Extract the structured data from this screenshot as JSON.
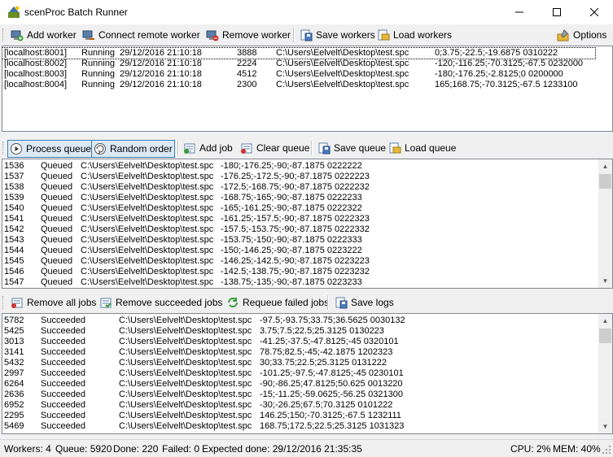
{
  "window": {
    "title": "scenProc Batch Runner"
  },
  "workers_toolbar": {
    "add_worker": "Add worker",
    "connect_remote_worker": "Connect remote worker",
    "remove_worker": "Remove worker",
    "save_workers": "Save workers",
    "load_workers": "Load workers",
    "options": "Options"
  },
  "workers": [
    {
      "host": "[localhost:8001]",
      "status": "Running",
      "started": "29/12/2016 21:10:18",
      "pid": "3888",
      "file": "C:\\Users\\Eelvelt\\Desktop\\test.spc",
      "args": "0;3.75;-22.5;-19.6875 0310222"
    },
    {
      "host": "[localhost:8002]",
      "status": "Running",
      "started": "29/12/2016 21:10:18",
      "pid": "2224",
      "file": "C:\\Users\\Eelvelt\\Desktop\\test.spc",
      "args": "-120;-116.25;-70.3125;-67.5 0232000"
    },
    {
      "host": "[localhost:8003]",
      "status": "Running",
      "started": "29/12/2016 21:10:18",
      "pid": "4512",
      "file": "C:\\Users\\Eelvelt\\Desktop\\test.spc",
      "args": "-180;-176.25;-2.8125;0 0200000"
    },
    {
      "host": "[localhost:8004]",
      "status": "Running",
      "started": "29/12/2016 21:10:18",
      "pid": "2300",
      "file": "C:\\Users\\Eelvelt\\Desktop\\test.spc",
      "args": "165;168.75;-70.3125;-67.5 1233100"
    }
  ],
  "queue_toolbar": {
    "process_queue": "Process queue",
    "random_order": "Random order",
    "add_job": "Add job",
    "clear_queue": "Clear queue",
    "save_queue": "Save queue",
    "load_queue": "Load queue"
  },
  "queue": [
    {
      "id": "1536",
      "status": "Queued",
      "file": "C:\\Users\\Eelvelt\\Desktop\\test.spc",
      "args": "-180;-176.25;-90;-87.1875 0222222"
    },
    {
      "id": "1537",
      "status": "Queued",
      "file": "C:\\Users\\Eelvelt\\Desktop\\test.spc",
      "args": "-176.25;-172.5;-90;-87.1875 0222223"
    },
    {
      "id": "1538",
      "status": "Queued",
      "file": "C:\\Users\\Eelvelt\\Desktop\\test.spc",
      "args": "-172.5;-168.75;-90;-87.1875 0222232"
    },
    {
      "id": "1539",
      "status": "Queued",
      "file": "C:\\Users\\Eelvelt\\Desktop\\test.spc",
      "args": "-168.75;-165;-90;-87.1875 0222233"
    },
    {
      "id": "1540",
      "status": "Queued",
      "file": "C:\\Users\\Eelvelt\\Desktop\\test.spc",
      "args": "-165;-161.25;-90;-87.1875 0222322"
    },
    {
      "id": "1541",
      "status": "Queued",
      "file": "C:\\Users\\Eelvelt\\Desktop\\test.spc",
      "args": "-161.25;-157.5;-90;-87.1875 0222323"
    },
    {
      "id": "1542",
      "status": "Queued",
      "file": "C:\\Users\\Eelvelt\\Desktop\\test.spc",
      "args": "-157.5;-153.75;-90;-87.1875 0222332"
    },
    {
      "id": "1543",
      "status": "Queued",
      "file": "C:\\Users\\Eelvelt\\Desktop\\test.spc",
      "args": "-153.75;-150;-90;-87.1875 0222333"
    },
    {
      "id": "1544",
      "status": "Queued",
      "file": "C:\\Users\\Eelvelt\\Desktop\\test.spc",
      "args": "-150;-146.25;-90;-87.1875 0223222"
    },
    {
      "id": "1545",
      "status": "Queued",
      "file": "C:\\Users\\Eelvelt\\Desktop\\test.spc",
      "args": "-146.25;-142.5;-90;-87.1875 0223223"
    },
    {
      "id": "1546",
      "status": "Queued",
      "file": "C:\\Users\\Eelvelt\\Desktop\\test.spc",
      "args": "-142.5;-138.75;-90;-87.1875 0223232"
    },
    {
      "id": "1547",
      "status": "Queued",
      "file": "C:\\Users\\Eelvelt\\Desktop\\test.spc",
      "args": "-138.75;-135;-90;-87.1875 0223233"
    }
  ],
  "jobs_toolbar": {
    "remove_all_jobs": "Remove all jobs",
    "remove_succeeded_jobs": "Remove succeeded jobs",
    "requeue_failed_jobs": "Requeue failed jobs",
    "save_logs": "Save logs"
  },
  "jobs": [
    {
      "id": "5782",
      "status": "Succeeded",
      "file": "C:\\Users\\Eelvelt\\Desktop\\test.spc",
      "args": "-97.5;-93.75;33.75;36.5625 0030132"
    },
    {
      "id": "5425",
      "status": "Succeeded",
      "file": "C:\\Users\\Eelvelt\\Desktop\\test.spc",
      "args": "3.75;7.5;22.5;25.3125 0130223"
    },
    {
      "id": "3013",
      "status": "Succeeded",
      "file": "C:\\Users\\Eelvelt\\Desktop\\test.spc",
      "args": "-41.25;-37.5;-47.8125;-45 0320101"
    },
    {
      "id": "3141",
      "status": "Succeeded",
      "file": "C:\\Users\\Eelvelt\\Desktop\\test.spc",
      "args": "78.75;82.5;-45;-42.1875 1202323"
    },
    {
      "id": "5432",
      "status": "Succeeded",
      "file": "C:\\Users\\Eelvelt\\Desktop\\test.spc",
      "args": "30;33.75;22.5;25.3125 0131222"
    },
    {
      "id": "2997",
      "status": "Succeeded",
      "file": "C:\\Users\\Eelvelt\\Desktop\\test.spc",
      "args": "-101.25;-97.5;-47.8125;-45 0230101"
    },
    {
      "id": "6264",
      "status": "Succeeded",
      "file": "C:\\Users\\Eelvelt\\Desktop\\test.spc",
      "args": "-90;-86.25;47.8125;50.625 0013220"
    },
    {
      "id": "2636",
      "status": "Succeeded",
      "file": "C:\\Users\\Eelvelt\\Desktop\\test.spc",
      "args": "-15;-11.25;-59.0625;-56.25 0321300"
    },
    {
      "id": "6952",
      "status": "Succeeded",
      "file": "C:\\Users\\Eelvelt\\Desktop\\test.spc",
      "args": "-30;-26.25;67.5;70.3125 0101222"
    },
    {
      "id": "2295",
      "status": "Succeeded",
      "file": "C:\\Users\\Eelvelt\\Desktop\\test.spc",
      "args": "146.25;150;-70.3125;-67.5 1232111"
    },
    {
      "id": "5469",
      "status": "Succeeded",
      "file": "C:\\Users\\Eelvelt\\Desktop\\test.spc",
      "args": "168.75;172.5;22.5;25.3125 1031323"
    }
  ],
  "status": {
    "workers": "Workers: 4",
    "queue": "Queue: 5920",
    "done": "Done: 220",
    "failed": "Failed: 0",
    "expected": "Expected done: 29/12/2016 21:35:35",
    "cpu": "CPU: 2%",
    "mem": "MEM: 40%"
  },
  "colors": {
    "accent": "#3c7fb1",
    "selection_border": "#000000"
  }
}
